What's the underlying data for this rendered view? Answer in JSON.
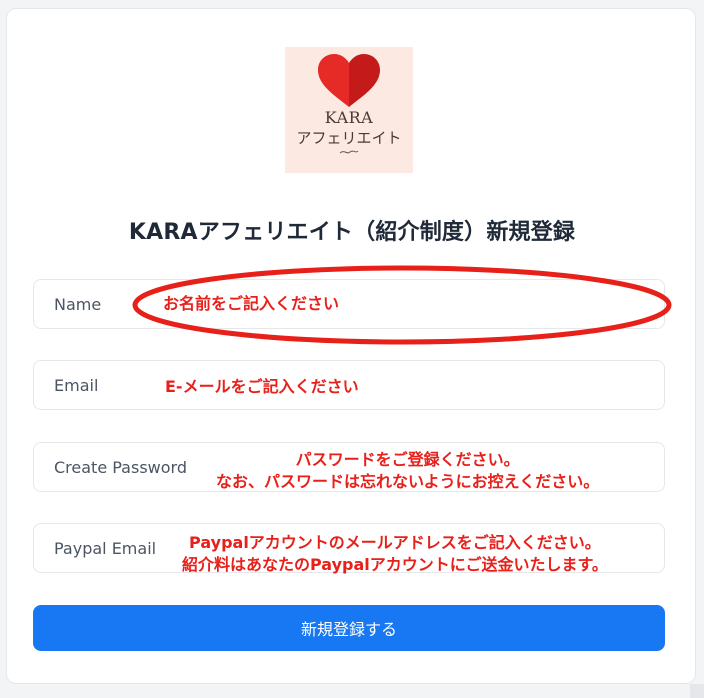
{
  "logo": {
    "title_en": "KARA",
    "title_jp": "アフェリエイト",
    "heart_icon": "heart-icon",
    "heart_color": "#e0201f",
    "background": "#fbe9e2"
  },
  "page_title": "KARAアフェリエイト（紹介制度）新規登録",
  "form": {
    "name_placeholder": "Name",
    "email_placeholder": "Email",
    "password_placeholder": "Create Password",
    "paypal_placeholder": "Paypal Email",
    "submit_label": "新規登録する"
  },
  "annotations": {
    "name": "お名前をご記入ください",
    "email": "E-メールをご記入ください",
    "password_line1": "パスワードをご登録ください。",
    "password_line2": "なお、パスワードは忘れないようにお控えください。",
    "paypal_line1": "Paypalアカウントのメールアドレスをご記入ください。",
    "paypal_line2": "紹介料はあなたのPaypalアカウントにご送金いたします。",
    "color": "#e8201a"
  },
  "colors": {
    "primary": "#1877f2",
    "title": "#1f2937",
    "border": "#e5e7eb"
  }
}
